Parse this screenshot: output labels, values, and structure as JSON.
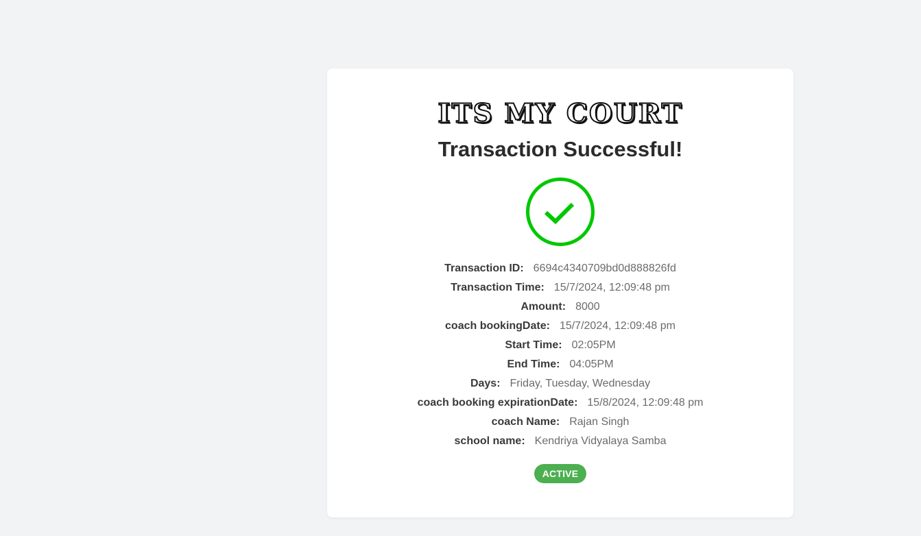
{
  "brand": {
    "logo_text": "ITS MY COURT"
  },
  "status": {
    "title": "Transaction Successful!",
    "icon": "check-circle-icon",
    "icon_color": "#00c800",
    "badge_label": "ACTIVE",
    "badge_color": "#4caf50"
  },
  "details": [
    {
      "label": "Transaction ID:",
      "value": "6694c4340709bd0d888826fd"
    },
    {
      "label": "Transaction Time:",
      "value": "15/7/2024, 12:09:48 pm"
    },
    {
      "label": "Amount:",
      "value": "8000"
    },
    {
      "label": "coach bookingDate:",
      "value": "15/7/2024, 12:09:48 pm"
    },
    {
      "label": "Start Time:",
      "value": "02:05PM"
    },
    {
      "label": "End Time:",
      "value": "04:05PM"
    },
    {
      "label": "Days:",
      "value": "Friday, Tuesday, Wednesday"
    },
    {
      "label": "coach booking expirationDate:",
      "value": "15/8/2024, 12:09:48 pm"
    },
    {
      "label": "coach Name:",
      "value": "Rajan Singh"
    },
    {
      "label": "school name:",
      "value": "Kendriya Vidyalaya Samba"
    }
  ]
}
